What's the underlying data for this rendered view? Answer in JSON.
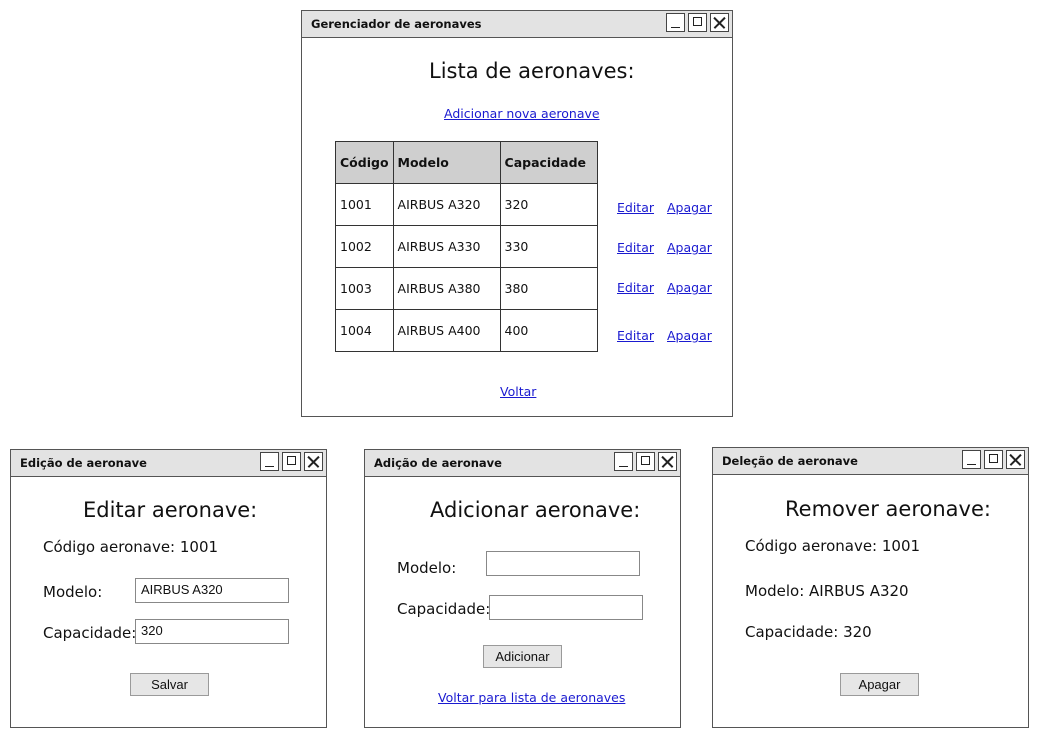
{
  "main_window": {
    "title": "Gerenciador de aeronaves",
    "heading": "Lista de aeronaves:",
    "add_link": "Adicionar nova aeronave",
    "table": {
      "headers": [
        "Código",
        "Modelo",
        "Capacidade"
      ],
      "rows": [
        [
          "1001",
          "AIRBUS A320",
          "320"
        ],
        [
          "1002",
          "AIRBUS A330",
          "330"
        ],
        [
          "1003",
          "AIRBUS A380",
          "380"
        ],
        [
          "1004",
          "AIRBUS A400",
          "400"
        ]
      ]
    },
    "edit_label": "Editar",
    "delete_label": "Apagar",
    "back_link": "Voltar"
  },
  "edit_window": {
    "title": "Edição de aeronave",
    "heading": "Editar aeronave:",
    "code_text": "Código aeronave: 1001",
    "model_label": "Modelo:",
    "model_value": "AIRBUS A320",
    "capacity_label": "Capacidade:",
    "capacity_value": "320",
    "save_button": "Salvar"
  },
  "add_window": {
    "title": "Adição de aeronave",
    "heading": "Adicionar aeronave:",
    "model_label": "Modelo:",
    "capacity_label": "Capacidade:",
    "add_button": "Adicionar",
    "back_link": "Voltar para lista de aeronaves"
  },
  "delete_window": {
    "title": "Deleção de aeronave",
    "heading": "Remover aeronave:",
    "code_text": "Código aeronave: 1001",
    "model_text": "Modelo: AIRBUS A320",
    "capacity_text": "Capacidade: 320",
    "delete_button": "Apagar"
  }
}
